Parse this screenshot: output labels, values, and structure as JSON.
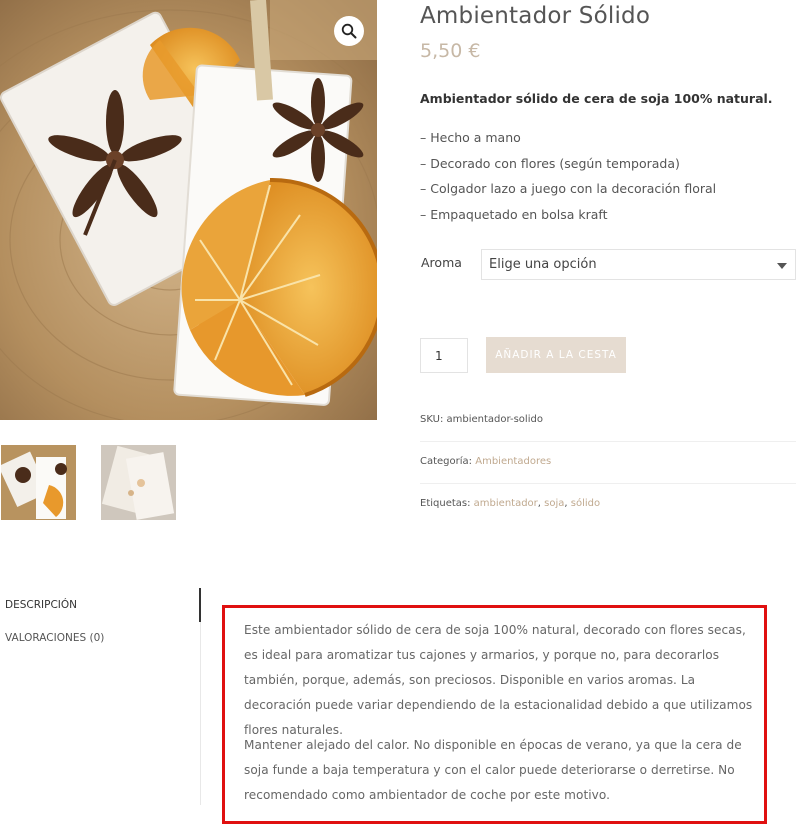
{
  "gallery": {
    "zoom_icon": "magnifier-icon",
    "thumbnails": [
      "thumb-main",
      "thumb-alt"
    ]
  },
  "product": {
    "title": "Ambientador Sólido",
    "price": "5,50 €",
    "short_description": "Ambientador sólido de cera de soja 100% natural.",
    "features": [
      "Hecho a mano",
      "Decorado con flores (según temporada)",
      "Colgador lazo a juego con la decoración floral",
      "Empaquetado en bolsa kraft"
    ]
  },
  "variation": {
    "label": "Aroma",
    "selected": "Elige una opción"
  },
  "cart": {
    "quantity": "1",
    "button_label": "AÑADIR A LA CESTA",
    "button_color": "#e6dcd1"
  },
  "meta": {
    "sku_label": "SKU:",
    "sku_value": "ambientador-solido",
    "category_label": "Categoría:",
    "category_value": "Ambientadores",
    "tags_label": "Etiquetas:",
    "tags": [
      "ambientador",
      "soja",
      "sólido"
    ],
    "link_color": "#c0a98f"
  },
  "tabs": {
    "description": "DESCRIPCIÓN",
    "reviews": "VALORACIONES (0)"
  },
  "description": {
    "paragraphs": [
      "Este ambientador sólido de cera de soja 100% natural, decorado con flores secas, es ideal para aromatizar tus cajones y armarios, y porque no, para decorarlos también, porque, además, son preciosos. Disponible en varios aromas. La decoración puede variar dependiendo de la estacionalidad debido a que utilizamos flores naturales.",
      "Mantener alejado del calor. No disponible en épocas de verano, ya que la cera de soja funde a baja temperatura y con el calor puede deteriorarse o derretirse. No recomendado como ambientador de coche por este motivo."
    ],
    "highlight_color": "#e01010"
  }
}
